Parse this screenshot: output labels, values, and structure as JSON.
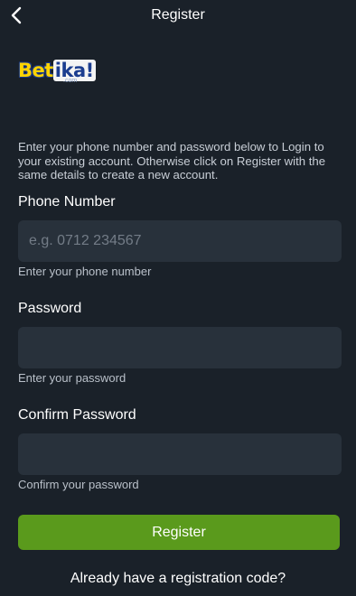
{
  "header": {
    "title": "Register",
    "back_icon": "chevron-left-icon"
  },
  "logo": {
    "part1": "Bet",
    "part2": "ika!",
    "sub": ".com"
  },
  "intro_text": "Enter your phone number and password below to Login to your existing account. Otherwise click on Register with the same details to create a new account.",
  "form": {
    "phone": {
      "label": "Phone Number",
      "placeholder": "e.g. 0712 234567",
      "value": "",
      "hint": "Enter your phone number"
    },
    "password": {
      "label": "Password",
      "placeholder": "",
      "value": "",
      "hint": "Enter your password"
    },
    "confirm_password": {
      "label": "Confirm Password",
      "placeholder": "",
      "value": "",
      "hint": "Confirm your password"
    }
  },
  "register_button": "Register",
  "registration_code_link": "Already have a registration code?",
  "colors": {
    "background": "#1a2129",
    "input_background": "#28313b",
    "button_green": "#5a9a1c"
  }
}
